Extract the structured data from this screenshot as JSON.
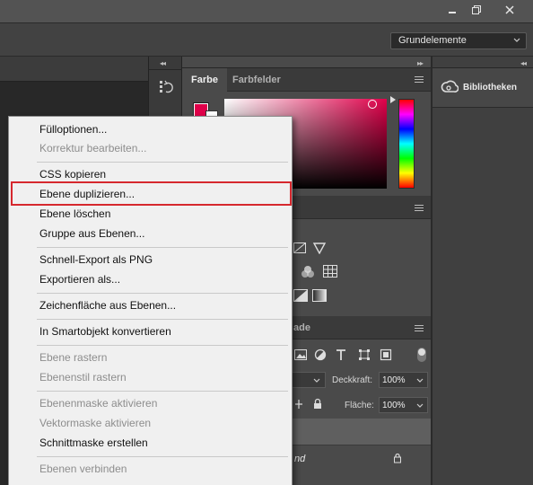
{
  "window": {
    "minimize_icon": "minimize-icon",
    "restore_icon": "restore-icon",
    "close_icon": "close-icon"
  },
  "options_bar": {
    "workspace": "Grundelemente"
  },
  "color_panel": {
    "tabs": [
      "Farbe",
      "Farbfelder"
    ],
    "foreground_color": "#e0004a",
    "background_color": "#ffffff"
  },
  "libraries_panel": {
    "label": "Bibliotheken"
  },
  "layers_panel": {
    "tab_fragment": "ade",
    "opacity_label": "Deckkraft:",
    "opacity_value": "100%",
    "fill_label": "Fläche:",
    "fill_value": "100%",
    "layer_name_fragment": "nd"
  },
  "context_menu": {
    "items": [
      {
        "label": "Fülloptionen...",
        "enabled": true
      },
      {
        "label": "Korrektur bearbeiten...",
        "enabled": false
      },
      {
        "label": "CSS kopieren",
        "enabled": true
      },
      {
        "label": "Ebene duplizieren...",
        "enabled": true,
        "highlighted": true
      },
      {
        "label": "Ebene löschen",
        "enabled": true
      },
      {
        "label": "Gruppe aus Ebenen...",
        "enabled": true
      },
      {
        "label": "Schnell-Export als PNG",
        "enabled": true
      },
      {
        "label": "Exportieren als...",
        "enabled": true
      },
      {
        "label": "Zeichenfläche aus Ebenen...",
        "enabled": true
      },
      {
        "label": "In Smartobjekt konvertieren",
        "enabled": true
      },
      {
        "label": "Ebene rastern",
        "enabled": false
      },
      {
        "label": "Ebenenstil rastern",
        "enabled": false
      },
      {
        "label": "Ebenenmaske aktivieren",
        "enabled": false
      },
      {
        "label": "Vektormaske aktivieren",
        "enabled": false
      },
      {
        "label": "Schnittmaske erstellen",
        "enabled": true
      },
      {
        "label": "Ebenen verbinden",
        "enabled": false
      }
    ]
  },
  "colors": {
    "highlight_border": "#d6282e",
    "menu_background": "#f0f0f0",
    "ui_dark": "#2b2b2b"
  }
}
